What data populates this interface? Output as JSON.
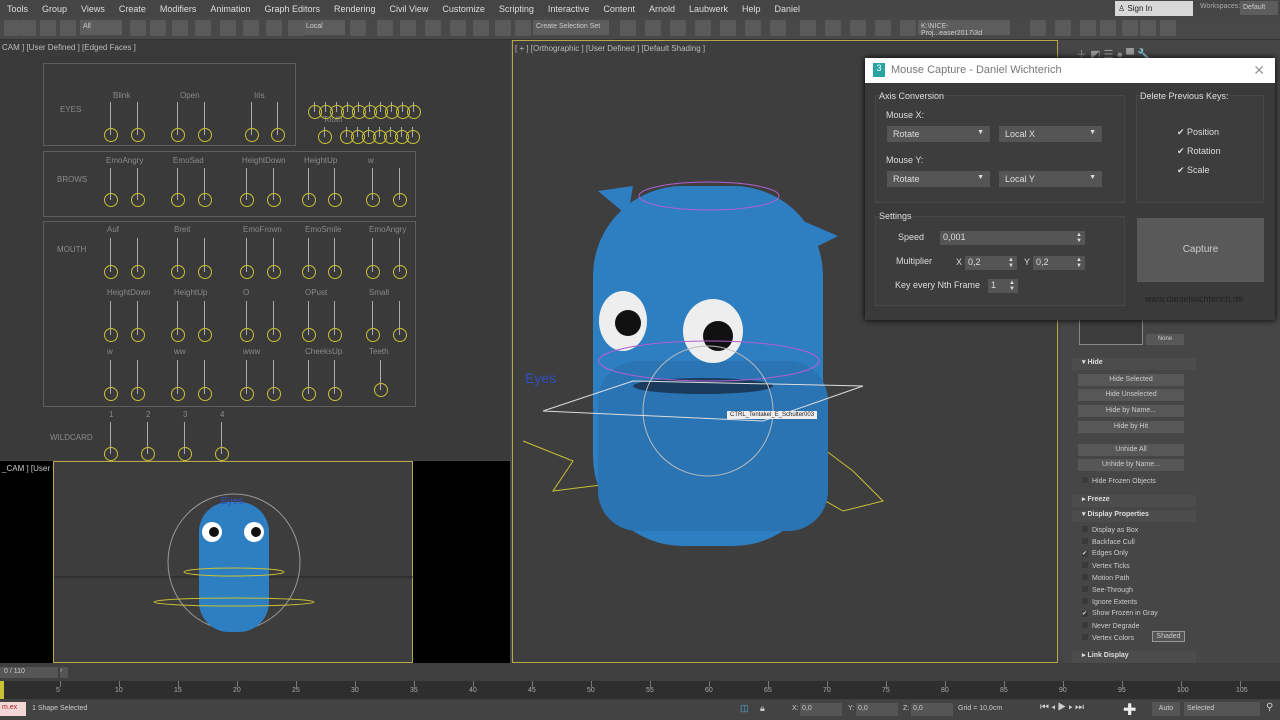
{
  "menu": [
    "Tools",
    "Group",
    "Views",
    "Create",
    "Modifiers",
    "Animation",
    "Graph Editors",
    "Rendering",
    "Civil View",
    "Customize",
    "Scripting",
    "Interactive",
    "Content",
    "Arnold",
    "Laubwerk",
    "Help",
    "Daniel"
  ],
  "toolbar": {
    "filter": "All",
    "coord": "Local",
    "selection_set": "Create Selection Set",
    "project_path": "K:\\NICE-Proj...easer2017\\3d",
    "sign_in": "Sign In",
    "workspaces_label": "Workspaces:",
    "workspace": "Default"
  },
  "viewports": {
    "top_left": "CAM ] [User Defined ] [Edged Faces ]",
    "bottom_left": "_CAM ] [User Defined ] [Default Shading ]",
    "right": "[ + ] [Orthographic ] [User Defined ] [Default Shading ]",
    "tooltip": "CTRL_Tentakel_E_Schulter003",
    "eyes_text": "Eyes"
  },
  "rig": {
    "eyes": {
      "title": "EYES",
      "labels": [
        "Blink",
        "Open",
        "Iris"
      ],
      "tooth": "Tooth"
    },
    "brows": {
      "title": "BROWS",
      "labels": [
        "EmoAngry",
        "EmoSad",
        "HeightDown",
        "HeightUp",
        "w"
      ]
    },
    "mouth": {
      "title": "MOUTH",
      "rows": [
        [
          "Auf",
          "Breit",
          "EmoFrown",
          "EmoSmile",
          "EmoAngry"
        ],
        [
          "HeightDown",
          "HeightUp",
          "O",
          "OPust",
          "Small"
        ],
        [
          "w",
          "ww",
          "www",
          "CheeksUp",
          "Teeth"
        ]
      ]
    },
    "wildcard": {
      "title": "WILDCARD",
      "labels": [
        "1",
        "2",
        "3",
        "4"
      ]
    }
  },
  "dialog": {
    "title": "Mouse Capture - Daniel Wichterich",
    "axis_conversion": "Axis Conversion",
    "mouse_x": "Mouse X:",
    "mouse_x_mode": "Rotate",
    "mouse_x_axis": "Local X",
    "mouse_y": "Mouse Y:",
    "mouse_y_mode": "Rotate",
    "mouse_y_axis": "Local Y",
    "delete_keys": "Delete Previous Keys:",
    "position": "Position",
    "rotation": "Rotation",
    "scale": "Scale",
    "settings": "Settings",
    "speed_label": "Speed",
    "speed": "0,001",
    "multiplier": "Multiplier",
    "x_label": "X",
    "mult_x": "0,2",
    "y_label": "Y",
    "mult_y": "0,2",
    "key_nth": "Key every Nth Frame",
    "key_nth_value": "1",
    "capture": "Capture",
    "website": "www.danielwichterich.de"
  },
  "cmd": {
    "none": "None",
    "hide": "Hide",
    "hide_buttons": [
      "Hide Selected",
      "Hide Unselected",
      "Hide by Name...",
      "Hide by Hit",
      "Unhide All",
      "Unhide by Name..."
    ],
    "hide_frozen": "Hide Frozen Objects",
    "freeze": "Freeze",
    "display_properties": "Display Properties",
    "display_items": [
      {
        "label": "Display as Box",
        "checked": false
      },
      {
        "label": "Backface Cull",
        "checked": false
      },
      {
        "label": "Edges Only",
        "checked": true
      },
      {
        "label": "Vertex Ticks",
        "checked": false
      },
      {
        "label": "Motion Path",
        "checked": false
      },
      {
        "label": "See-Through",
        "checked": false
      },
      {
        "label": "Ignore Extents",
        "checked": false
      },
      {
        "label": "Show Frozen in Gray",
        "checked": true
      },
      {
        "label": "Never Degrade",
        "checked": false
      },
      {
        "label": "Vertex Colors",
        "checked": false
      }
    ],
    "shaded": "Shaded",
    "link_display": "Link Display"
  },
  "timeline": {
    "frame": "0 / 110",
    "ticks": [
      "5",
      "10",
      "15",
      "20",
      "25",
      "30",
      "35",
      "40",
      "45",
      "50",
      "55",
      "60",
      "65",
      "70",
      "75",
      "80",
      "85",
      "90",
      "95",
      "100",
      "105"
    ]
  },
  "status": {
    "script": "m.ex",
    "selected": "1 Shape Selected",
    "x": "0,0",
    "y": "0,0",
    "z": "0,0",
    "x_label": "X:",
    "y_label": "Y:",
    "z_label": "Z:",
    "grid": "Grid = 10,0cm",
    "auto": "Auto",
    "key_mode": "Selected"
  },
  "colors": {
    "accent_yellow": "#b9a848",
    "character_blue": "#2e7fc2",
    "dialog_bg": "#3a3a3a"
  }
}
